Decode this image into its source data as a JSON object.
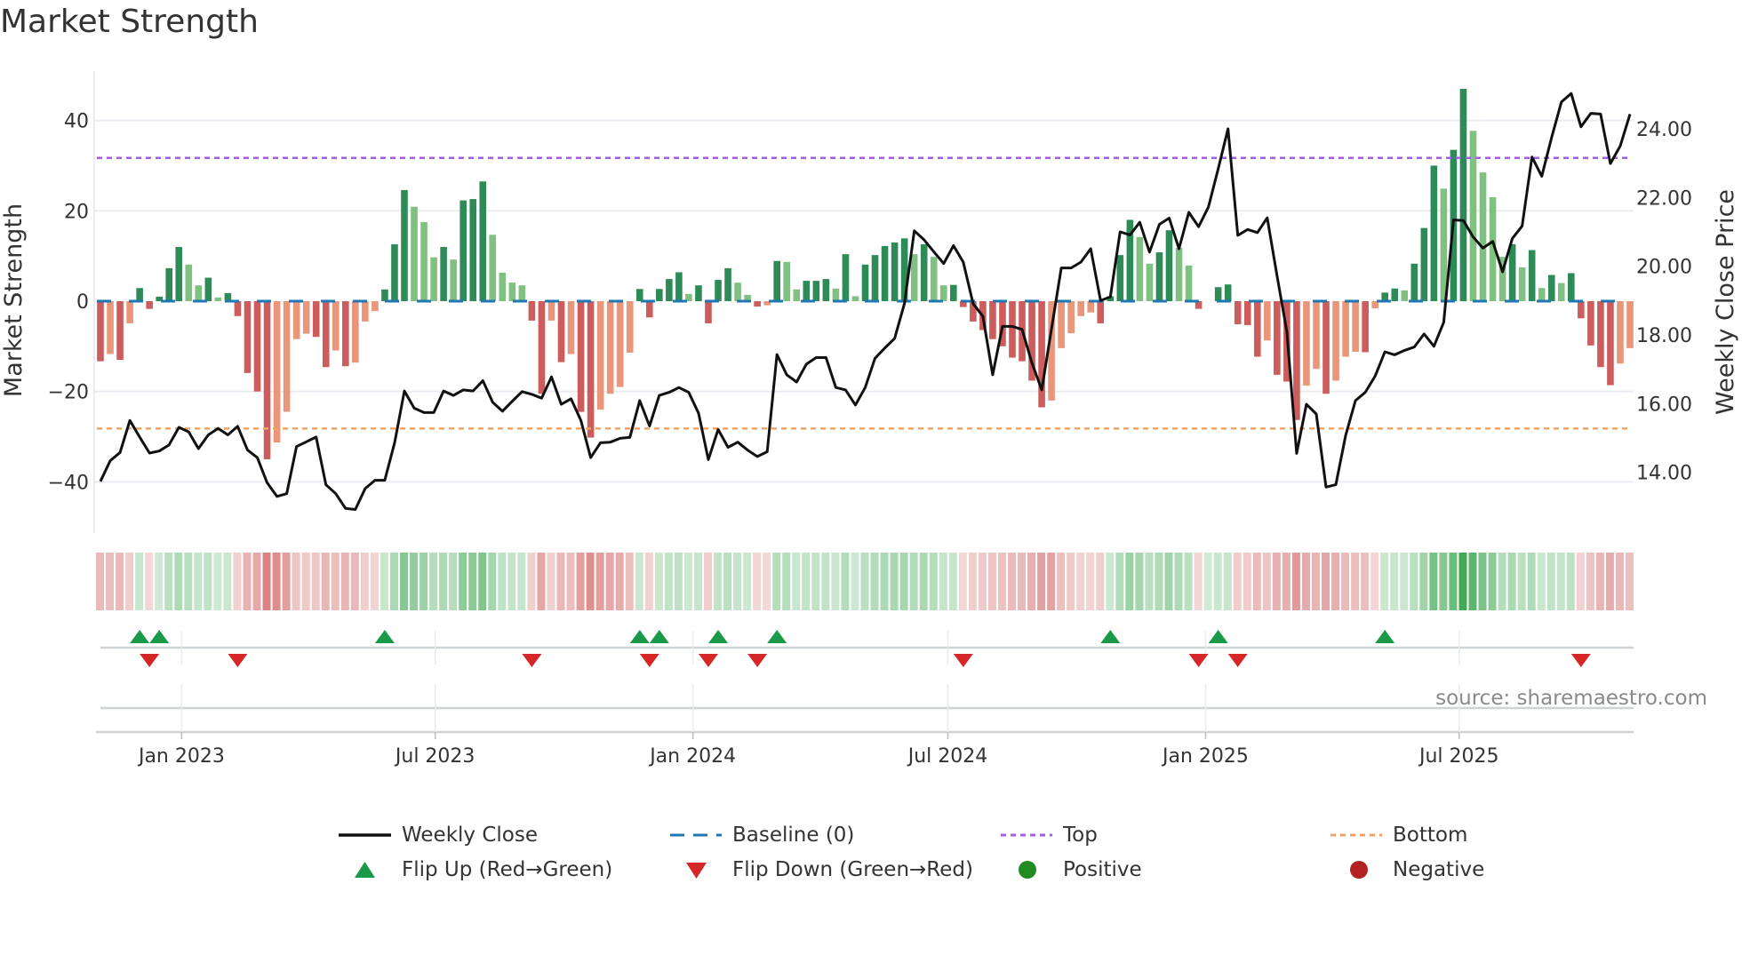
{
  "title": "Market Strength",
  "source": "source: sharemaestro.com",
  "legend": {
    "weekly_close": "Weekly Close",
    "baseline": "Baseline (0)",
    "top": "Top",
    "bottom": "Bottom",
    "flip_up": "Flip Up (Red→Green)",
    "flip_down": "Flip Down (Green→Red)",
    "positive": "Positive",
    "negative": "Negative"
  },
  "colors": {
    "strong_green": "#2e8b57",
    "weak_green": "#80c080",
    "strong_red": "#cd5c5c",
    "weak_red": "#e9967a",
    "line": "#111111",
    "baseline": "#1f77b4",
    "top": "#a15ee8",
    "bottom": "#f4a261",
    "flip_up": "#1a9a48",
    "flip_down": "#d62728",
    "positive": "#228b22",
    "negative": "#b22222"
  },
  "chart_data": {
    "type": "bar+line",
    "title": "Market Strength",
    "ylabel": "Market Strength",
    "y2label": "Weekly Close Price",
    "ylim": [
      -50,
      50
    ],
    "y2lim": [
      12.3,
      25.5
    ],
    "yticks": [
      {
        "v": 40,
        "label": "40"
      },
      {
        "v": 20,
        "label": "20"
      },
      {
        "v": 0,
        "label": "0"
      },
      {
        "v": -20,
        "label": "−20"
      },
      {
        "v": -40,
        "label": "−40"
      }
    ],
    "y2ticks": [
      {
        "v": 24,
        "label": "24.00"
      },
      {
        "v": 22,
        "label": "22.00"
      },
      {
        "v": 20,
        "label": "20.00"
      },
      {
        "v": 18,
        "label": "18.00"
      },
      {
        "v": 16,
        "label": "16.00"
      },
      {
        "v": 14,
        "label": "14.00"
      }
    ],
    "xticks": [
      {
        "date": "2023-01-01",
        "label": "Jan 2023"
      },
      {
        "date": "2023-07-01",
        "label": "Jul 2023"
      },
      {
        "date": "2024-01-01",
        "label": "Jan 2024"
      },
      {
        "date": "2024-07-01",
        "label": "Jul 2024"
      },
      {
        "date": "2025-01-01",
        "label": "Jan 2025"
      },
      {
        "date": "2025-07-01",
        "label": "Jul 2025"
      }
    ],
    "start_date": "2022-11-04",
    "frequency": "weekly",
    "top_level": 31.7,
    "bottom_level": -28.2,
    "baseline": 0,
    "strength": [
      -13.3,
      -11.7,
      -13,
      -4.9,
      2.9,
      -1.7,
      1,
      7.3,
      12,
      8.1,
      3.5,
      5.2,
      0.8,
      1.8,
      -3.3,
      -15.9,
      -20,
      -35,
      -31.3,
      -24.5,
      -8.4,
      -7.2,
      -7.9,
      -14.6,
      -10.9,
      -14.4,
      -13.6,
      -4.5,
      -2.2,
      2.6,
      12.6,
      24.6,
      20.9,
      17.5,
      9.7,
      12,
      9.2,
      22.3,
      22.6,
      26.5,
      14.7,
      6.3,
      4.1,
      3.5,
      -4.3,
      -20.5,
      -4.3,
      -13.5,
      -11.7,
      -24.5,
      -30.2,
      -24,
      -20.5,
      -19,
      -11.4,
      2.7,
      -3.6,
      2.7,
      4.9,
      6.4,
      1.6,
      3.5,
      -4.9,
      4.7,
      7.3,
      4.1,
      1.4,
      -1.2,
      -0.9,
      8.9,
      8.7,
      2.6,
      4.5,
      4.5,
      4.9,
      2.8,
      10.4,
      1.1,
      8.1,
      10.2,
      12.2,
      13,
      13.9,
      10.4,
      12.6,
      9.8,
      3.5,
      3.6,
      -1.3,
      -4.5,
      -6.4,
      -8.4,
      -10,
      -12.5,
      -13.3,
      -17.6,
      -23.5,
      -22,
      -10.4,
      -7.1,
      -3.3,
      -2.5,
      -4.9,
      1.1,
      10.2,
      18,
      14.2,
      8.3,
      10.8,
      15.7,
      11.8,
      7.9,
      -1.7,
      0,
      3.1,
      3.7,
      -5.1,
      -5.3,
      -12.3,
      -8.7,
      -16.3,
      -17.8,
      -26.3,
      -18.7,
      -15,
      -20.5,
      -17.6,
      -12.3,
      -11.2,
      -11.3,
      -1.6,
      1.9,
      2.8,
      2.4,
      8.3,
      16.2,
      30,
      24.9,
      33.5,
      47,
      37.7,
      28.5,
      23,
      9.8,
      12.6,
      7.5,
      11.3,
      2.9,
      5.8,
      4,
      6.2,
      -3.8,
      -9.8,
      -14.6,
      -18.6,
      -13.8,
      -10.4
    ],
    "weekly_close": [
      13.74,
      14.34,
      14.58,
      15.51,
      15.03,
      14.56,
      14.62,
      14.8,
      15.31,
      15.18,
      14.69,
      15.09,
      15.28,
      15.09,
      15.34,
      14.65,
      14.43,
      13.7,
      13.3,
      13.38,
      14.75,
      14.89,
      15.03,
      13.64,
      13.38,
      12.95,
      12.92,
      13.53,
      13.77,
      13.77,
      14.86,
      16.37,
      15.87,
      15.74,
      15.74,
      16.37,
      16.24,
      16.4,
      16.37,
      16.67,
      16.04,
      15.78,
      16.07,
      16.35,
      16.27,
      16.16,
      16.78,
      15.98,
      16.14,
      15.51,
      14.43,
      14.86,
      14.88,
      14.99,
      15.02,
      16.09,
      15.35,
      16.24,
      16.33,
      16.47,
      16.33,
      15.72,
      14.37,
      15.25,
      14.73,
      14.88,
      14.65,
      14.46,
      14.6,
      17.43,
      16.84,
      16.63,
      17.15,
      17.34,
      17.34,
      16.47,
      16.4,
      15.96,
      16.47,
      17.32,
      17.62,
      17.9,
      18.91,
      21.03,
      20.77,
      20.42,
      20.08,
      20.6,
      20.12,
      18.91,
      18.54,
      16.84,
      18.25,
      18.25,
      18.16,
      17.19,
      16.4,
      18.18,
      19.95,
      19.95,
      20.12,
      20.51,
      19,
      19.11,
      21,
      20.91,
      21.28,
      20.41,
      21.22,
      21.4,
      20.51,
      21.57,
      21.15,
      21.72,
      22.84,
      24.0,
      20.9,
      21.07,
      20.98,
      21.41,
      19.73,
      18.1,
      14.55,
      15.98,
      15.7,
      13.57,
      13.64,
      15.08,
      16.09,
      16.33,
      16.8,
      17.51,
      17.42,
      17.55,
      17.65,
      18.03,
      17.67,
      18.37,
      21.35,
      21.33,
      20.85,
      20.53,
      20.72,
      19.84,
      20.81,
      21.17,
      23.18,
      22.62,
      23.74,
      24.78,
      25.03,
      24.06,
      24.45,
      24.43,
      22.99,
      23.5,
      24.43
    ],
    "legend_placement": "bottom-center",
    "grid": true
  }
}
